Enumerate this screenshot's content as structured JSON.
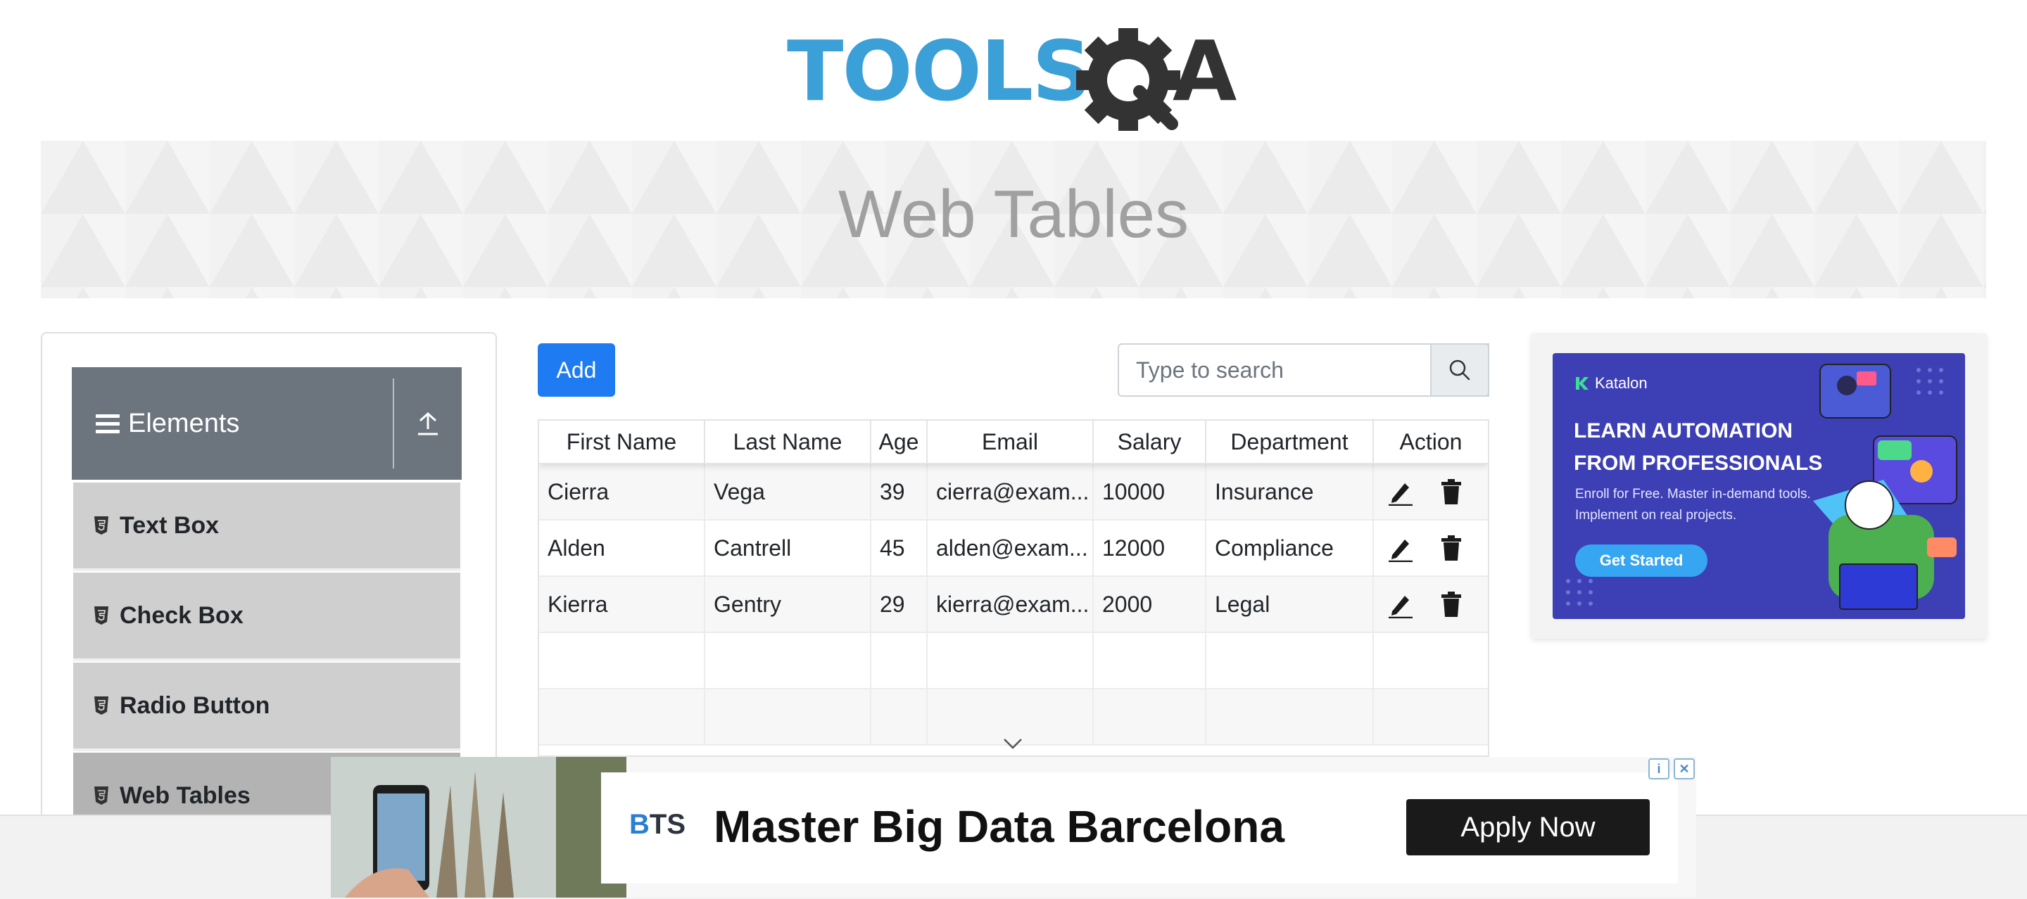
{
  "logo": {
    "text_left": "TOOLS",
    "text_right": "A"
  },
  "banner": {
    "title": "Web Tables"
  },
  "sidebar": {
    "group_title": "Elements",
    "items": [
      {
        "label": "Text Box"
      },
      {
        "label": "Check Box"
      },
      {
        "label": "Radio Button"
      },
      {
        "label": "Web Tables",
        "active": true
      }
    ]
  },
  "toolbar": {
    "add_label": "Add",
    "search_placeholder": "Type to search"
  },
  "table": {
    "headers": [
      "First Name",
      "Last Name",
      "Age",
      "Email",
      "Salary",
      "Department",
      "Action"
    ],
    "rows": [
      [
        "Cierra",
        "Vega",
        "39",
        "cierra@exam...",
        "10000",
        "Insurance"
      ],
      [
        "Alden",
        "Cantrell",
        "45",
        "alden@exam...",
        "12000",
        "Compliance"
      ],
      [
        "Kierra",
        "Gentry",
        "29",
        "kierra@exam...",
        "2000",
        "Legal"
      ]
    ],
    "empty_rows": 2
  },
  "right_ad": {
    "brand": "Katalon",
    "headline": "LEARN AUTOMATION FROM PROFESSIONALS",
    "subtext": "Enroll for Free. Master in-demand tools. Implement on real projects.",
    "cta": "Get Started"
  },
  "bottom_ad": {
    "brand_b": "B",
    "brand_ts": "TS",
    "title": "Master Big Data Barcelona",
    "cta": "Apply Now"
  },
  "colors": {
    "primary": "#1e7bf2",
    "sidebar_header": "#6c757d",
    "sidebar_item": "#cfcfcf",
    "logo_blue": "#3b9fd8",
    "ad_purple": "#3d3fb4"
  }
}
